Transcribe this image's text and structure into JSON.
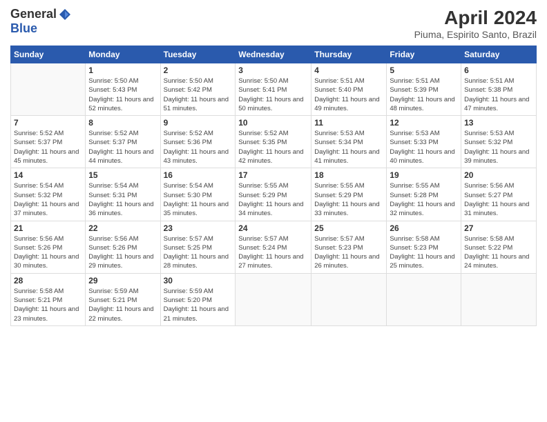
{
  "header": {
    "logo_general": "General",
    "logo_blue": "Blue",
    "title": "April 2024",
    "location": "Piuma, Espirito Santo, Brazil"
  },
  "columns": [
    "Sunday",
    "Monday",
    "Tuesday",
    "Wednesday",
    "Thursday",
    "Friday",
    "Saturday"
  ],
  "weeks": [
    [
      {
        "day": "",
        "sunrise": "",
        "sunset": "",
        "daylight": ""
      },
      {
        "day": "1",
        "sunrise": "Sunrise: 5:50 AM",
        "sunset": "Sunset: 5:43 PM",
        "daylight": "Daylight: 11 hours and 52 minutes."
      },
      {
        "day": "2",
        "sunrise": "Sunrise: 5:50 AM",
        "sunset": "Sunset: 5:42 PM",
        "daylight": "Daylight: 11 hours and 51 minutes."
      },
      {
        "day": "3",
        "sunrise": "Sunrise: 5:50 AM",
        "sunset": "Sunset: 5:41 PM",
        "daylight": "Daylight: 11 hours and 50 minutes."
      },
      {
        "day": "4",
        "sunrise": "Sunrise: 5:51 AM",
        "sunset": "Sunset: 5:40 PM",
        "daylight": "Daylight: 11 hours and 49 minutes."
      },
      {
        "day": "5",
        "sunrise": "Sunrise: 5:51 AM",
        "sunset": "Sunset: 5:39 PM",
        "daylight": "Daylight: 11 hours and 48 minutes."
      },
      {
        "day": "6",
        "sunrise": "Sunrise: 5:51 AM",
        "sunset": "Sunset: 5:38 PM",
        "daylight": "Daylight: 11 hours and 47 minutes."
      }
    ],
    [
      {
        "day": "7",
        "sunrise": "Sunrise: 5:52 AM",
        "sunset": "Sunset: 5:37 PM",
        "daylight": "Daylight: 11 hours and 45 minutes."
      },
      {
        "day": "8",
        "sunrise": "Sunrise: 5:52 AM",
        "sunset": "Sunset: 5:37 PM",
        "daylight": "Daylight: 11 hours and 44 minutes."
      },
      {
        "day": "9",
        "sunrise": "Sunrise: 5:52 AM",
        "sunset": "Sunset: 5:36 PM",
        "daylight": "Daylight: 11 hours and 43 minutes."
      },
      {
        "day": "10",
        "sunrise": "Sunrise: 5:52 AM",
        "sunset": "Sunset: 5:35 PM",
        "daylight": "Daylight: 11 hours and 42 minutes."
      },
      {
        "day": "11",
        "sunrise": "Sunrise: 5:53 AM",
        "sunset": "Sunset: 5:34 PM",
        "daylight": "Daylight: 11 hours and 41 minutes."
      },
      {
        "day": "12",
        "sunrise": "Sunrise: 5:53 AM",
        "sunset": "Sunset: 5:33 PM",
        "daylight": "Daylight: 11 hours and 40 minutes."
      },
      {
        "day": "13",
        "sunrise": "Sunrise: 5:53 AM",
        "sunset": "Sunset: 5:32 PM",
        "daylight": "Daylight: 11 hours and 39 minutes."
      }
    ],
    [
      {
        "day": "14",
        "sunrise": "Sunrise: 5:54 AM",
        "sunset": "Sunset: 5:32 PM",
        "daylight": "Daylight: 11 hours and 37 minutes."
      },
      {
        "day": "15",
        "sunrise": "Sunrise: 5:54 AM",
        "sunset": "Sunset: 5:31 PM",
        "daylight": "Daylight: 11 hours and 36 minutes."
      },
      {
        "day": "16",
        "sunrise": "Sunrise: 5:54 AM",
        "sunset": "Sunset: 5:30 PM",
        "daylight": "Daylight: 11 hours and 35 minutes."
      },
      {
        "day": "17",
        "sunrise": "Sunrise: 5:55 AM",
        "sunset": "Sunset: 5:29 PM",
        "daylight": "Daylight: 11 hours and 34 minutes."
      },
      {
        "day": "18",
        "sunrise": "Sunrise: 5:55 AM",
        "sunset": "Sunset: 5:29 PM",
        "daylight": "Daylight: 11 hours and 33 minutes."
      },
      {
        "day": "19",
        "sunrise": "Sunrise: 5:55 AM",
        "sunset": "Sunset: 5:28 PM",
        "daylight": "Daylight: 11 hours and 32 minutes."
      },
      {
        "day": "20",
        "sunrise": "Sunrise: 5:56 AM",
        "sunset": "Sunset: 5:27 PM",
        "daylight": "Daylight: 11 hours and 31 minutes."
      }
    ],
    [
      {
        "day": "21",
        "sunrise": "Sunrise: 5:56 AM",
        "sunset": "Sunset: 5:26 PM",
        "daylight": "Daylight: 11 hours and 30 minutes."
      },
      {
        "day": "22",
        "sunrise": "Sunrise: 5:56 AM",
        "sunset": "Sunset: 5:26 PM",
        "daylight": "Daylight: 11 hours and 29 minutes."
      },
      {
        "day": "23",
        "sunrise": "Sunrise: 5:57 AM",
        "sunset": "Sunset: 5:25 PM",
        "daylight": "Daylight: 11 hours and 28 minutes."
      },
      {
        "day": "24",
        "sunrise": "Sunrise: 5:57 AM",
        "sunset": "Sunset: 5:24 PM",
        "daylight": "Daylight: 11 hours and 27 minutes."
      },
      {
        "day": "25",
        "sunrise": "Sunrise: 5:57 AM",
        "sunset": "Sunset: 5:23 PM",
        "daylight": "Daylight: 11 hours and 26 minutes."
      },
      {
        "day": "26",
        "sunrise": "Sunrise: 5:58 AM",
        "sunset": "Sunset: 5:23 PM",
        "daylight": "Daylight: 11 hours and 25 minutes."
      },
      {
        "day": "27",
        "sunrise": "Sunrise: 5:58 AM",
        "sunset": "Sunset: 5:22 PM",
        "daylight": "Daylight: 11 hours and 24 minutes."
      }
    ],
    [
      {
        "day": "28",
        "sunrise": "Sunrise: 5:58 AM",
        "sunset": "Sunset: 5:21 PM",
        "daylight": "Daylight: 11 hours and 23 minutes."
      },
      {
        "day": "29",
        "sunrise": "Sunrise: 5:59 AM",
        "sunset": "Sunset: 5:21 PM",
        "daylight": "Daylight: 11 hours and 22 minutes."
      },
      {
        "day": "30",
        "sunrise": "Sunrise: 5:59 AM",
        "sunset": "Sunset: 5:20 PM",
        "daylight": "Daylight: 11 hours and 21 minutes."
      },
      {
        "day": "",
        "sunrise": "",
        "sunset": "",
        "daylight": ""
      },
      {
        "day": "",
        "sunrise": "",
        "sunset": "",
        "daylight": ""
      },
      {
        "day": "",
        "sunrise": "",
        "sunset": "",
        "daylight": ""
      },
      {
        "day": "",
        "sunrise": "",
        "sunset": "",
        "daylight": ""
      }
    ]
  ]
}
